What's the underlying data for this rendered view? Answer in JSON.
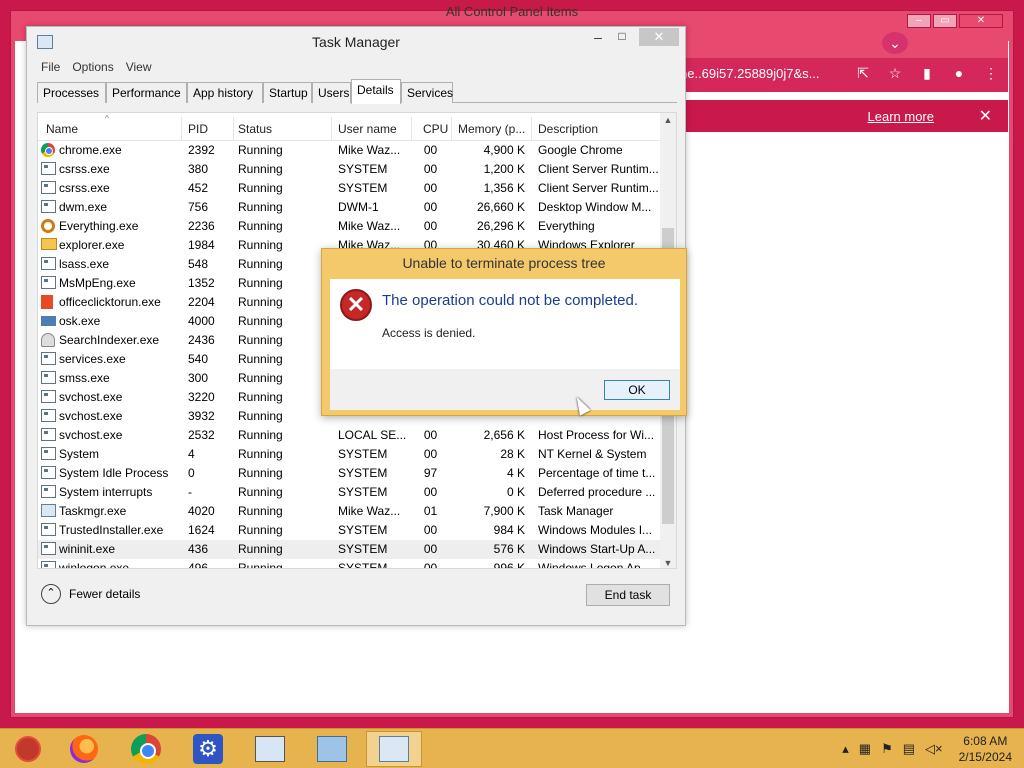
{
  "background_window": {
    "title": "All Control Panel Items",
    "controls": [
      "–",
      "▭",
      "✕"
    ]
  },
  "browser": {
    "url": "he..69i57.25889j0j7&s...",
    "learn_more": "Learn more",
    "close": "✕",
    "icons": [
      "share-icon",
      "star-icon",
      "sidebar-icon",
      "profile-icon",
      "menu-icon"
    ]
  },
  "task_manager": {
    "title": "Task Manager",
    "controls": {
      "minimize": "–",
      "maximize": "□",
      "close": "✕"
    },
    "menu": [
      "File",
      "Options",
      "View"
    ],
    "tabs": [
      "Processes",
      "Performance",
      "App history",
      "Startup",
      "Users",
      "Details",
      "Services"
    ],
    "active_tab": "Details",
    "columns": [
      "Name",
      "PID",
      "Status",
      "User name",
      "CPU",
      "Memory (p...",
      "Description"
    ],
    "sort_indicator": "^",
    "processes": [
      {
        "icon": "chrome-icon",
        "name": "chrome.exe",
        "pid": "2392",
        "status": "Running",
        "user": "Mike Waz...",
        "cpu": "00",
        "memory": "4,900 K",
        "description": "Google Chrome"
      },
      {
        "icon": "window-icon",
        "name": "csrss.exe",
        "pid": "380",
        "status": "Running",
        "user": "SYSTEM",
        "cpu": "00",
        "memory": "1,200 K",
        "description": "Client Server Runtim..."
      },
      {
        "icon": "window-icon",
        "name": "csrss.exe",
        "pid": "452",
        "status": "Running",
        "user": "SYSTEM",
        "cpu": "00",
        "memory": "1,356 K",
        "description": "Client Server Runtim..."
      },
      {
        "icon": "window-icon",
        "name": "dwm.exe",
        "pid": "756",
        "status": "Running",
        "user": "DWM-1",
        "cpu": "00",
        "memory": "26,660 K",
        "description": "Desktop Window M..."
      },
      {
        "icon": "search-icon",
        "name": "Everything.exe",
        "pid": "2236",
        "status": "Running",
        "user": "Mike Waz...",
        "cpu": "00",
        "memory": "26,296 K",
        "description": "Everything"
      },
      {
        "icon": "folder-icon",
        "name": "explorer.exe",
        "pid": "1984",
        "status": "Running",
        "user": "Mike Waz...",
        "cpu": "00",
        "memory": "30,460 K",
        "description": "Windows Explorer"
      },
      {
        "icon": "window-icon",
        "name": "lsass.exe",
        "pid": "548",
        "status": "Running",
        "user": "",
        "cpu": "",
        "memory": "",
        "description": ""
      },
      {
        "icon": "window-icon",
        "name": "MsMpEng.exe",
        "pid": "1352",
        "status": "Running",
        "user": "",
        "cpu": "",
        "memory": "",
        "description": ""
      },
      {
        "icon": "office-icon",
        "name": "officeclicktorun.exe",
        "pid": "2204",
        "status": "Running",
        "user": "",
        "cpu": "",
        "memory": "",
        "description": ""
      },
      {
        "icon": "keyboard-icon",
        "name": "osk.exe",
        "pid": "4000",
        "status": "Running",
        "user": "",
        "cpu": "",
        "memory": "",
        "description": ""
      },
      {
        "icon": "person-icon",
        "name": "SearchIndexer.exe",
        "pid": "2436",
        "status": "Running",
        "user": "",
        "cpu": "",
        "memory": "",
        "description": ""
      },
      {
        "icon": "window-icon",
        "name": "services.exe",
        "pid": "540",
        "status": "Running",
        "user": "",
        "cpu": "",
        "memory": "",
        "description": ""
      },
      {
        "icon": "window-icon",
        "name": "smss.exe",
        "pid": "300",
        "status": "Running",
        "user": "",
        "cpu": "",
        "memory": "",
        "description": ""
      },
      {
        "icon": "window-icon",
        "name": "svchost.exe",
        "pid": "3220",
        "status": "Running",
        "user": "",
        "cpu": "",
        "memory": "",
        "description": ""
      },
      {
        "icon": "window-icon",
        "name": "svchost.exe",
        "pid": "3932",
        "status": "Running",
        "user": "",
        "cpu": "",
        "memory": "",
        "description": ""
      },
      {
        "icon": "window-icon",
        "name": "svchost.exe",
        "pid": "2532",
        "status": "Running",
        "user": "LOCAL SE...",
        "cpu": "00",
        "memory": "2,656 K",
        "description": "Host Process for Wi..."
      },
      {
        "icon": "window-icon",
        "name": "System",
        "pid": "4",
        "status": "Running",
        "user": "SYSTEM",
        "cpu": "00",
        "memory": "28 K",
        "description": "NT Kernel & System"
      },
      {
        "icon": "window-icon",
        "name": "System Idle Process",
        "pid": "0",
        "status": "Running",
        "user": "SYSTEM",
        "cpu": "97",
        "memory": "4 K",
        "description": "Percentage of time t..."
      },
      {
        "icon": "window-icon",
        "name": "System interrupts",
        "pid": "-",
        "status": "Running",
        "user": "SYSTEM",
        "cpu": "00",
        "memory": "0 K",
        "description": "Deferred procedure ..."
      },
      {
        "icon": "task-manager-icon",
        "name": "Taskmgr.exe",
        "pid": "4020",
        "status": "Running",
        "user": "Mike Waz...",
        "cpu": "01",
        "memory": "7,900 K",
        "description": "Task Manager"
      },
      {
        "icon": "window-icon",
        "name": "TrustedInstaller.exe",
        "pid": "1624",
        "status": "Running",
        "user": "SYSTEM",
        "cpu": "00",
        "memory": "984 K",
        "description": "Windows Modules I..."
      },
      {
        "icon": "window-icon",
        "name": "wininit.exe",
        "pid": "436",
        "status": "Running",
        "user": "SYSTEM",
        "cpu": "00",
        "memory": "576 K",
        "description": "Windows Start-Up A...",
        "selected": true
      },
      {
        "icon": "window-icon",
        "name": "winlogon.exe",
        "pid": "496",
        "status": "Running",
        "user": "SYSTEM",
        "cpu": "00",
        "memory": "996 K",
        "description": "Windows Logon Ap..."
      }
    ],
    "fewer_details": "Fewer details",
    "end_task": "End task"
  },
  "dialog": {
    "title": "Unable to terminate process tree",
    "main_instruction": "The operation could not be completed.",
    "content": "Access is denied.",
    "ok": "OK",
    "icon": "error-icon"
  },
  "taskbar": {
    "items": [
      "ornament-icon",
      "firefox-icon",
      "chrome-icon",
      "settings-icon",
      "keyboard-icon",
      "control-panel-icon",
      "task-manager-icon"
    ],
    "active_item": "task-manager-icon",
    "tray_icons": [
      "chevron-up-icon",
      "window-icon",
      "flag-icon",
      "network-icon",
      "volume-muted-icon"
    ],
    "time": "6:08 AM",
    "date": "2/15/2024"
  },
  "colors": {
    "accent": "#e8496f",
    "taskbar": "#e7b34e",
    "dialog_frame": "#f4c96b",
    "error": "#c62828",
    "instruction_text": "#1a3d8f"
  }
}
